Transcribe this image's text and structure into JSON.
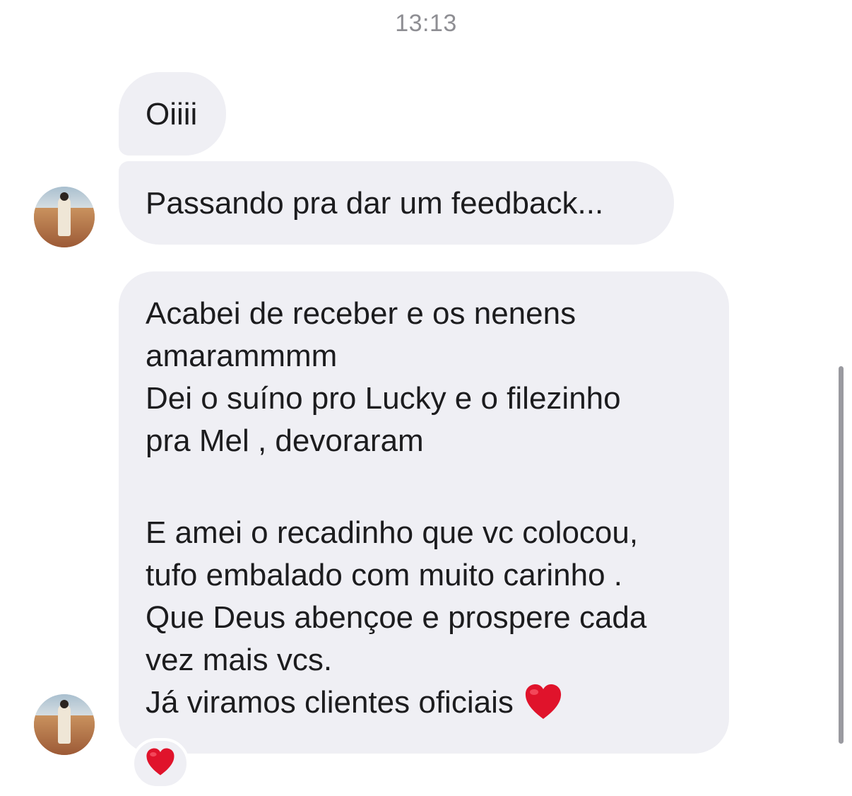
{
  "header": {
    "time": "13:13"
  },
  "messages": [
    {
      "lines": [
        "Oiiii"
      ]
    },
    {
      "lines": [
        "Passando pra dar um feedback..."
      ]
    },
    {
      "lines": [
        "Acabei de receber e os nenens",
        "amarammmm",
        "Dei o suíno pro Lucky e o filezinho",
        "pra Mel , devoraram",
        "",
        "E amei o recadinho que vc colocou,",
        "tufo embalado com muito carinho .",
        "Que Deus abençoe e prospere cada",
        "vez mais vcs.",
        "Já viramos clientes oficiais"
      ],
      "trailing_icon": "red-heart-icon",
      "reaction_icon": "red-heart-icon"
    }
  ],
  "colors": {
    "bubble": "#efeff4",
    "text": "#1c1c1e",
    "timestamp": "#8e8e93",
    "heart": "#e0132b",
    "scrollbar": "#9a9aa0"
  }
}
